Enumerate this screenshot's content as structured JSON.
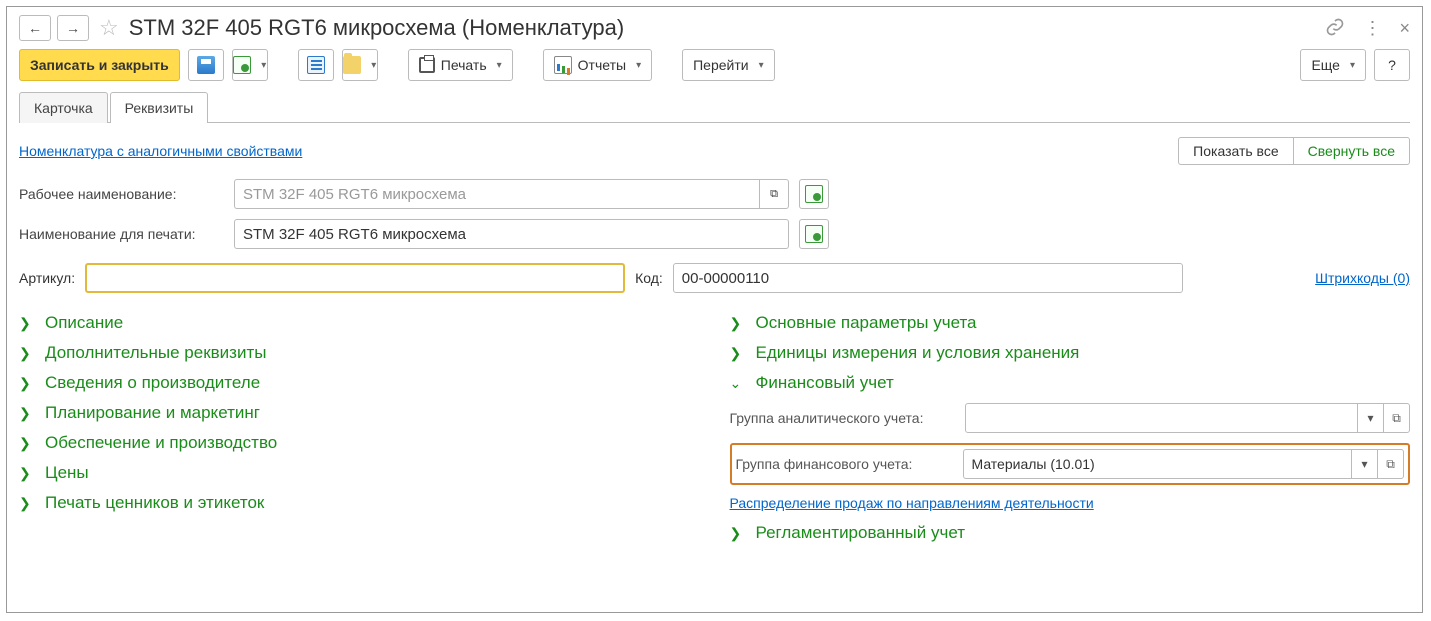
{
  "title": "STM 32F 405 RGT6 микросхема (Номенклатура)",
  "toolbar": {
    "save_close": "Записать и закрыть",
    "print": "Печать",
    "reports": "Отчеты",
    "goto": "Перейти",
    "more": "Еще",
    "help": "?"
  },
  "tabs": {
    "card": "Карточка",
    "details": "Реквизиты"
  },
  "links": {
    "similar": "Номенклатура с аналогичными свойствами",
    "barcodes": "Штрихкоды (0)",
    "distribution": "Распределение продаж по направлениям деятельности"
  },
  "expand_buttons": {
    "show_all": "Показать все",
    "collapse_all": "Свернуть все"
  },
  "fields": {
    "work_name_label": "Рабочее наименование:",
    "work_name_value": "STM 32F 405 RGT6 микросхема",
    "print_name_label": "Наименование для печати:",
    "print_name_value": "STM 32F 405 RGT6 микросхема",
    "article_label": "Артикул:",
    "article_value": "",
    "code_label": "Код:",
    "code_value": "00-00000110"
  },
  "left_sections": {
    "description": "Описание",
    "extra": "Дополнительные реквизиты",
    "manufacturer": "Сведения о производителе",
    "planning": "Планирование и маркетинг",
    "supply": "Обеспечение и производство",
    "prices": "Цены",
    "labels": "Печать ценников и этикеток"
  },
  "right_sections": {
    "params": "Основные параметры учета",
    "units": "Единицы измерения и условия хранения",
    "finance": "Финансовый учет",
    "regulated": "Регламентированный учет"
  },
  "finance": {
    "analytic_label": "Группа аналитического учета:",
    "analytic_value": "",
    "group_label": "Группа финансового учета:",
    "group_value": "Материалы (10.01)"
  }
}
